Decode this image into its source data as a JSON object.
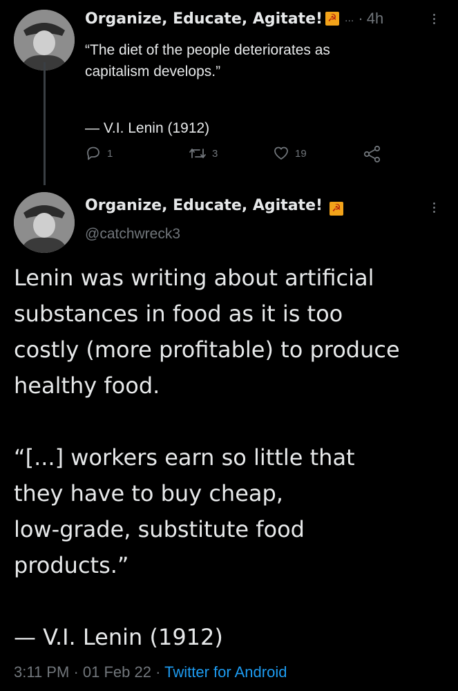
{
  "tweet1": {
    "display_name": "Organize, Educate, Agitate!",
    "badge_icon": "hammer-sickle-flag-icon",
    "ellipsis": "...",
    "separator": "·",
    "time": "4h",
    "text_lines": [
      "“The diet of the people deteriorates as",
      "capitalism develops.”",
      "",
      "— V.I. Lenin (1912)"
    ],
    "actions": {
      "reply_count": "1",
      "retweet_count": "3",
      "like_count": "19"
    }
  },
  "tweet2": {
    "display_name": "Organize, Educate, Agitate!",
    "badge_icon": "hammer-sickle-flag-icon",
    "handle": "@catchwreck3",
    "paragraphs": [
      [
        "Lenin was writing about artificial",
        "substances in food as it is too",
        "costly (more profitable) to produce",
        "healthy food."
      ],
      [
        "“[...] workers earn so little that",
        "they have to buy cheap,",
        "low-grade, substitute food",
        "products.”"
      ],
      [
        "— V.I. Lenin (1912)"
      ]
    ],
    "timestamp": "3:11 PM",
    "date": "01 Feb 22",
    "separator": "·",
    "source": "Twitter for Android"
  },
  "colors": {
    "background": "#000000",
    "text": "#e7e9ea",
    "muted": "#71767b",
    "link": "#1d9bf0",
    "thread_line": "#3a3f44",
    "flag": "#f2a31a"
  }
}
